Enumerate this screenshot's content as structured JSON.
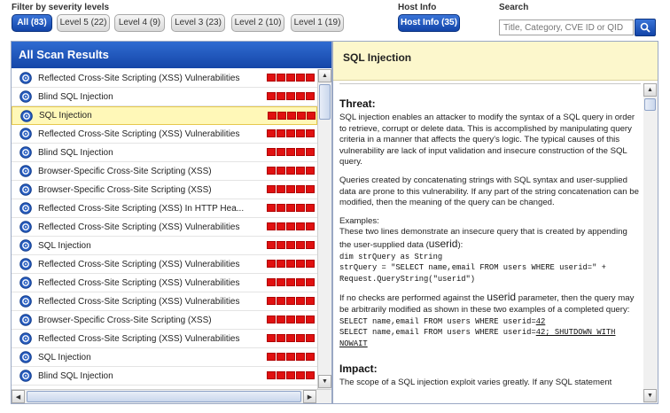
{
  "filter": {
    "label": "Filter by severity levels",
    "buttons": [
      {
        "label": "All (83)",
        "active": true
      },
      {
        "label": "Level 5 (22)",
        "active": false
      },
      {
        "label": "Level 4 (9)",
        "active": false
      },
      {
        "label": "Level 3 (23)",
        "active": false
      },
      {
        "label": "Level 2 (10)",
        "active": false
      },
      {
        "label": "Level 1 (19)",
        "active": false
      }
    ]
  },
  "host": {
    "label": "Host Info",
    "button": "Host Info (35)"
  },
  "search": {
    "label": "Search",
    "placeholder": "Title, Category, CVE ID or QID"
  },
  "results": {
    "title": "All Scan Results",
    "severity_color": "#e01010",
    "items": [
      {
        "title": "Reflected Cross-Site Scripting (XSS) Vulnerabilities",
        "selected": false
      },
      {
        "title": "Blind SQL Injection",
        "selected": false
      },
      {
        "title": "SQL Injection",
        "selected": true
      },
      {
        "title": "Reflected Cross-Site Scripting (XSS) Vulnerabilities",
        "selected": false
      },
      {
        "title": "Blind SQL Injection",
        "selected": false
      },
      {
        "title": "Browser-Specific Cross-Site Scripting (XSS)",
        "selected": false
      },
      {
        "title": "Browser-Specific Cross-Site Scripting (XSS)",
        "selected": false
      },
      {
        "title": "Reflected Cross-Site Scripting (XSS) In HTTP Hea...",
        "selected": false
      },
      {
        "title": "Reflected Cross-Site Scripting (XSS) Vulnerabilities",
        "selected": false
      },
      {
        "title": "SQL Injection",
        "selected": false
      },
      {
        "title": "Reflected Cross-Site Scripting (XSS) Vulnerabilities",
        "selected": false
      },
      {
        "title": "Reflected Cross-Site Scripting (XSS) Vulnerabilities",
        "selected": false
      },
      {
        "title": "Reflected Cross-Site Scripting (XSS) Vulnerabilities",
        "selected": false
      },
      {
        "title": "Browser-Specific Cross-Site Scripting (XSS)",
        "selected": false
      },
      {
        "title": "Reflected Cross-Site Scripting (XSS) Vulnerabilities",
        "selected": false
      },
      {
        "title": "SQL Injection",
        "selected": false
      },
      {
        "title": "Blind SQL Injection",
        "selected": false
      }
    ]
  },
  "detail": {
    "title": "SQL Injection",
    "threat_heading": "Threat:",
    "threat_p1": "SQL injection enables an attacker to modify the syntax of a SQL query in order to retrieve, corrupt or delete data. This is accomplished by manipulating query criteria in a manner that affects the query's logic. The typical causes of this vulnerability are lack of input validation and insecure construction of the SQL query.",
    "threat_p2": "Queries created by concatenating strings with SQL syntax and user-supplied data are prone to this vulnerability. If any part of the string concatenation can be modified, then the meaning of the query can be changed.",
    "examples_label": "Examples:",
    "examples_intro": "These two lines demonstrate an insecure query that is created by appending the user-supplied data (",
    "userid": "userid",
    "examples_intro_end": "):",
    "code1": "dim strQuery as String",
    "code2": "strQuery = \"SELECT name,email FROM users WHERE userid=\" +",
    "code3": "Request.QueryString(\"userid\")",
    "nochecks_a": "If no checks are performed against the ",
    "nochecks_b": " parameter, then the query may be arbitrarily modified as shown in these two examples of a completed query:",
    "q1_prefix": "SELECT name,email FROM users WHERE userid=",
    "q1_value": "42",
    "q2_prefix": "SELECT name,email FROM users WHERE userid=",
    "q2_value": "42; SHUTDOWN WITH NOWAIT",
    "impact_heading": "Impact:",
    "impact_p": "The scope of a SQL injection exploit varies greatly. If any SQL statement"
  }
}
